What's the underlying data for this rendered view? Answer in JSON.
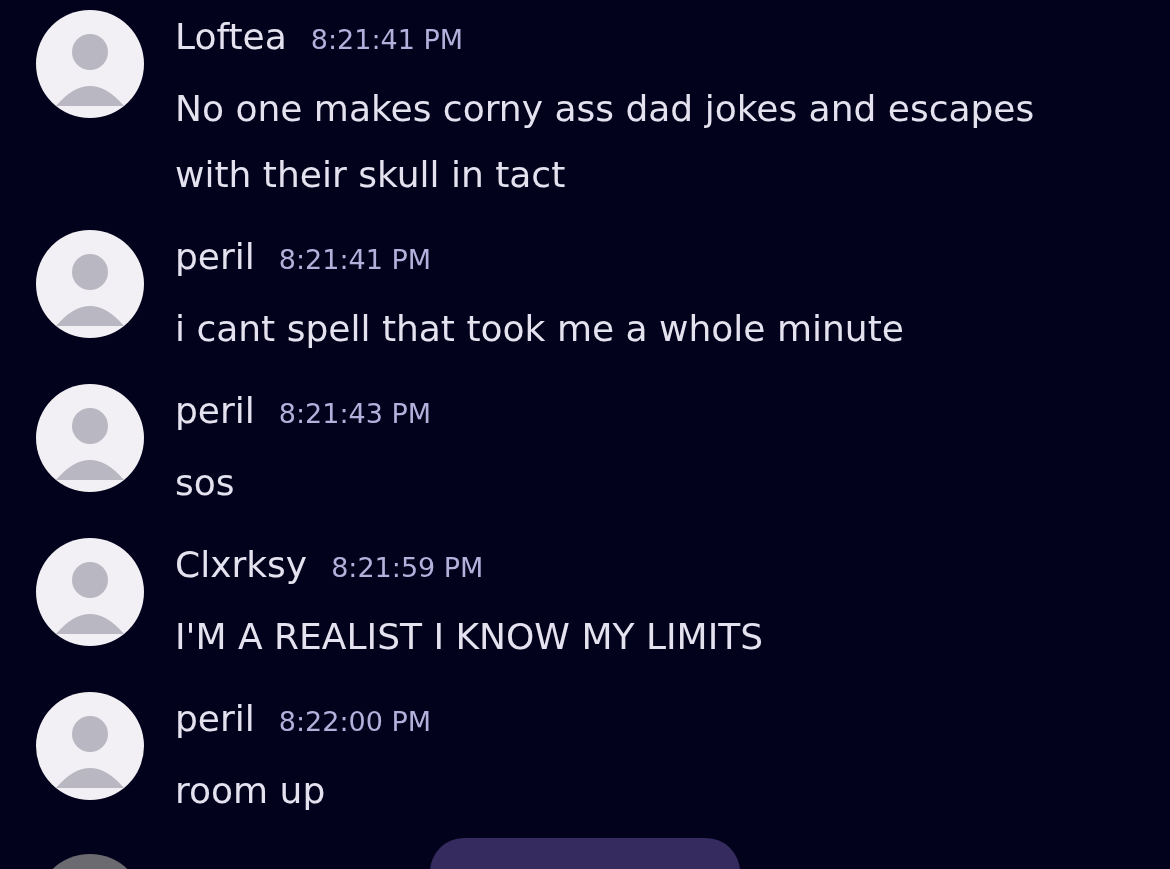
{
  "messages": [
    {
      "author": "Loftea",
      "time": "8:21:41 PM",
      "text": "No one makes corny ass dad jokes and escapes with their skull in tact"
    },
    {
      "author": "peril",
      "time": "8:21:41 PM",
      "text": "i cant spell that took me a whole minute"
    },
    {
      "author": "peril",
      "time": "8:21:43 PM",
      "text": "sos"
    },
    {
      "author": "Clxrksy",
      "time": "8:21:59 PM",
      "text": "I'M A REALIST I KNOW MY LIMITS"
    },
    {
      "author": "peril",
      "time": "8:22:00 PM",
      "text": "room up"
    }
  ]
}
